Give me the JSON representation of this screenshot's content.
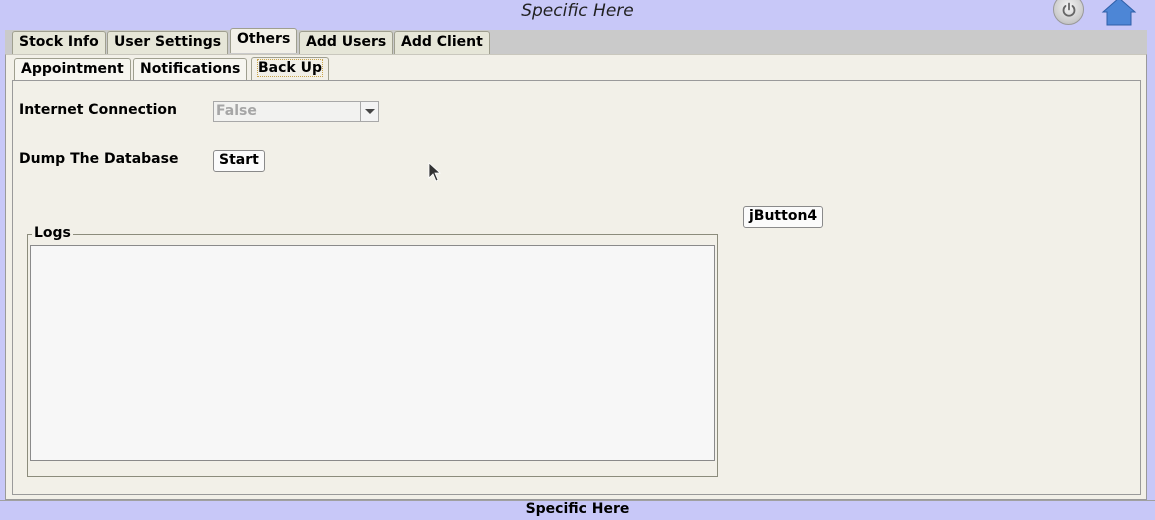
{
  "header": {
    "title": "Specific Here",
    "power_icon": "power-icon",
    "home_icon": "home-icon"
  },
  "main_tabs": [
    {
      "label": "Stock Info",
      "active": false
    },
    {
      "label": "User Settings",
      "active": false
    },
    {
      "label": "Others",
      "active": true
    },
    {
      "label": "Add Users",
      "active": false
    },
    {
      "label": "Add Client",
      "active": false
    }
  ],
  "sub_tabs": [
    {
      "label": "Appointment",
      "active": false
    },
    {
      "label": "Notifications",
      "active": false
    },
    {
      "label": "Back Up",
      "active": true
    }
  ],
  "backup": {
    "internet_label": "Internet Connection",
    "internet_value": "False",
    "dump_label": "Dump The Database",
    "start_label": "Start",
    "extra_button_label": "jButton4",
    "logs_legend": "Logs",
    "logs_text": ""
  },
  "footer": {
    "status": "Specific Here"
  },
  "colors": {
    "frame": "#c8c8f8",
    "panel": "#f2f0e8",
    "tabbar": "#cacaca"
  }
}
